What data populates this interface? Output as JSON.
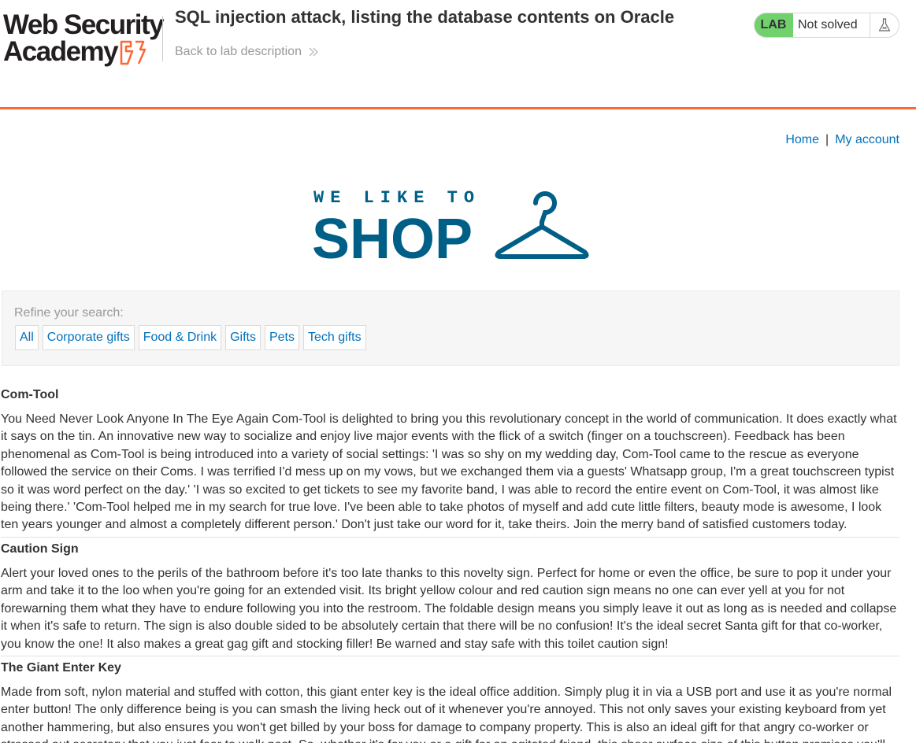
{
  "academy": {
    "logo_line1": "Web Security",
    "logo_line2": "Academy",
    "lab_title": "SQL injection attack, listing the database contents on Oracle",
    "back_link": "Back to lab description",
    "lab_badge": "LAB",
    "lab_status": "Not solved",
    "accent_color": "#ff6633"
  },
  "nav": {
    "home": "Home",
    "separator": "|",
    "account": "My account"
  },
  "banner": {
    "tagline": "WE LIKE TO",
    "word": "SHOP",
    "color": "#005f86"
  },
  "filters": {
    "label": "Refine your search:",
    "categories": [
      "All",
      "Corporate gifts",
      "Food & Drink",
      "Gifts",
      "Pets",
      "Tech gifts"
    ]
  },
  "products": [
    {
      "name": "Com-Tool",
      "description": "You Need Never Look Anyone In The Eye Again Com-Tool is delighted to bring you this revolutionary concept in the world of communication. It does exactly what it says on the tin. An innovative new way to socialize and enjoy live major events with the flick of a switch (finger on a touchscreen). Feedback has been phenomenal as Com-Tool is being introduced into a variety of social settings: 'I was so shy on my wedding day, Com-Tool came to the rescue as everyone followed the service on their Coms. I was terrified I'd mess up on my vows, but we exchanged them via a guests' Whatsapp group, I'm a great touchscreen typist so it was word perfect on the day.' 'I was so excited to get tickets to see my favorite band, I was able to record the entire event on Com-Tool, it was almost like being there.' 'Com-Tool helped me in my search for true love. I've been able to take photos of myself and add cute little filters, beauty mode is awesome, I look ten years younger and almost a completely different person.' Don't just take our word for it, take theirs. Join the merry band of satisfied customers today."
    },
    {
      "name": "Caution Sign",
      "description": "Alert your loved ones to the perils of the bathroom before it's too late thanks to this novelty sign. Perfect for home or even the office, be sure to pop it under your arm and take it to the loo when you're going for an extended visit. Its bright yellow colour and red caution sign means no one can ever yell at you for not forewarning them what they have to endure following you into the restroom. The foldable design means you simply leave it out as long as is needed and collapse it when it's safe to return. The sign is also double sided to be absolutely certain that there will be no confusion! It's the ideal secret Santa gift for that co-worker, you know the one! It also makes a great gag gift and stocking filler! Be warned and stay safe with this toilet caution sign!"
    },
    {
      "name": "The Giant Enter Key",
      "description": "Made from soft, nylon material and stuffed with cotton, this giant enter key is the ideal office addition. Simply plug it in via a USB port and use it as you're normal enter button! The only difference being is you can smash the living heck out of it whenever you're annoyed. This not only saves your existing keyboard from yet another hammering, but also ensures you won't get billed by your boss for damage to company property. This is also an ideal gift for that angry co-worker or stressed out secretary that you just fear to walk past. So, whether it's for you or a gift for an agitated friend, this sheer surface size of this button promises you'll"
    }
  ]
}
